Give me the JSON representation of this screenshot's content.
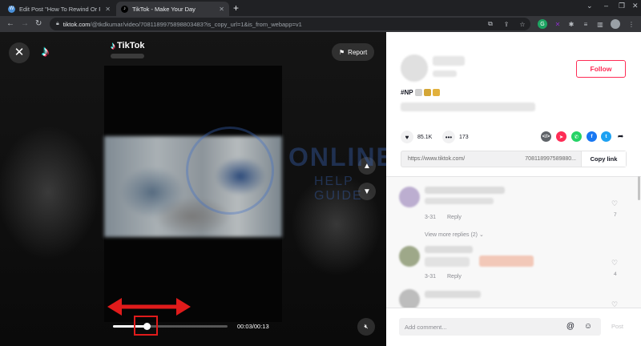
{
  "browser": {
    "tabs": [
      {
        "title": "Edit Post \"How To Rewind Or Fast",
        "active": false
      },
      {
        "title": "TikTok - Make Your Day",
        "active": true
      }
    ],
    "url": {
      "host": "tiktok.com",
      "path": "/@tkdkumar/video/7081189975898803483?is_copy_url=1&is_from_webapp=v1"
    }
  },
  "player": {
    "brand_name": "TikTok",
    "report_label": "Report",
    "time_text": "00:03/00:13",
    "progress_fraction": 0.3
  },
  "watermark": {
    "line1": "ONLINE",
    "line2": "HELP GUIDE"
  },
  "sidebar": {
    "follow_label": "Follow",
    "hashtag": "#NP",
    "likes_count": "85.1K",
    "comments_count": "173",
    "share_url": "https://www.tiktok.com/",
    "share_code": "708118997589880...",
    "copy_link_label": "Copy link",
    "comments": [
      {
        "date": "3-31",
        "reply_label": "Reply",
        "like_count": "7"
      },
      {
        "date": "3-31",
        "reply_label": "Reply",
        "like_count": "4"
      }
    ],
    "view_more_label": "View more replies (2)",
    "comment_placeholder": "Add comment...",
    "post_label": "Post"
  },
  "colors": {
    "accent": "#fe2c55",
    "annotation": "#e01b1b",
    "watermark": "#3c6ec8"
  },
  "icons": [
    "close-icon",
    "tiktok-logo-icon",
    "flag-icon",
    "chevron-up-icon",
    "chevron-down-icon",
    "mute-icon",
    "heart-icon",
    "comment-icon",
    "embed-icon",
    "whatsapp-icon",
    "facebook-icon",
    "twitter-icon",
    "share-arrow-icon",
    "at-icon",
    "emoji-icon"
  ]
}
